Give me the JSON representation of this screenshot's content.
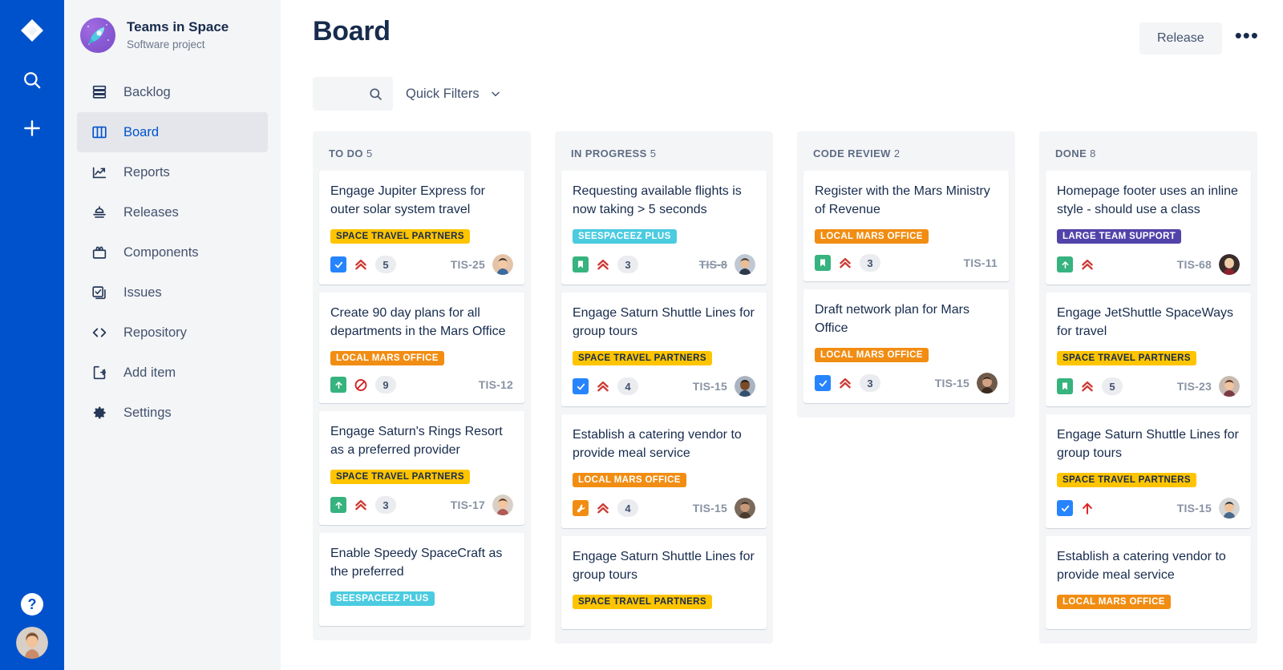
{
  "rail": {
    "logo_icon": "jira-logo-icon",
    "search_icon": "search-icon",
    "create_icon": "plus-icon",
    "help_label": "?",
    "avatar_icon": "user-avatar"
  },
  "sidebar": {
    "project": {
      "name": "Teams in Space",
      "subtitle": "Software project",
      "avatar_icon": "rocket-icon"
    },
    "items": [
      {
        "label": "Backlog",
        "icon": "backlog-icon",
        "active": false
      },
      {
        "label": "Board",
        "icon": "board-icon",
        "active": true
      },
      {
        "label": "Reports",
        "icon": "reports-icon",
        "active": false
      },
      {
        "label": "Releases",
        "icon": "releases-icon",
        "active": false
      },
      {
        "label": "Components",
        "icon": "components-icon",
        "active": false
      },
      {
        "label": "Issues",
        "icon": "issues-icon",
        "active": false
      },
      {
        "label": "Repository",
        "icon": "repository-icon",
        "active": false
      },
      {
        "label": "Add item",
        "icon": "add-item-icon",
        "active": false
      },
      {
        "label": "Settings",
        "icon": "settings-icon",
        "active": false
      }
    ]
  },
  "header": {
    "title": "Board",
    "release_label": "Release",
    "more_label": "•••",
    "more_icon": "ellipsis-icon"
  },
  "filters": {
    "search_value": "",
    "search_placeholder": "",
    "search_icon": "search-icon",
    "quick_filters_label": "Quick Filters",
    "chevron_icon": "chevron-down-icon"
  },
  "epic_colors": {
    "SPACE TRAVEL PARTNERS": {
      "bg": "#FFC400",
      "fg": "#172B4D"
    },
    "LOCAL MARS OFFICE": {
      "bg": "#F18D13",
      "fg": "#FFFFFF"
    },
    "SEESPACEEZ PLUS": {
      "bg": "#4BCBE0",
      "fg": "#FFFFFF"
    },
    "LARGE TEAM SUPPORT": {
      "bg": "#5243AA",
      "fg": "#FFFFFF"
    }
  },
  "board": {
    "columns": [
      {
        "title": "TO DO",
        "count": "5",
        "cards": [
          {
            "title": "Engage Jupiter Express for outer solar system travel",
            "epic": "SPACE TRAVEL PARTNERS",
            "type": "task",
            "priority": "high",
            "count": "5",
            "key": "TIS-25",
            "key_struck": false,
            "avatar": "avatar-m1"
          },
          {
            "title": "Create 90 day plans for all departments in the Mars Office",
            "epic": "LOCAL MARS OFFICE",
            "type": "improvement",
            "priority": "blocked",
            "count": "9",
            "key": "TIS-12",
            "key_struck": false,
            "avatar": null
          },
          {
            "title": "Engage Saturn's Rings Resort as a preferred provider",
            "epic": "SPACE TRAVEL PARTNERS",
            "type": "improvement",
            "priority": "high",
            "count": "3",
            "key": "TIS-17",
            "key_struck": false,
            "avatar": "avatar-f1"
          },
          {
            "title": "Enable Speedy SpaceCraft as the preferred",
            "epic": "SEESPACEEZ PLUS",
            "type": null,
            "priority": null,
            "count": null,
            "key": null,
            "key_struck": false,
            "avatar": null
          }
        ]
      },
      {
        "title": "IN PROGRESS",
        "count": "5",
        "cards": [
          {
            "title": "Requesting available flights is now taking > 5 seconds",
            "epic": "SEESPACEEZ PLUS",
            "type": "story",
            "priority": "high",
            "count": "3",
            "key": "TIS-8",
            "key_struck": true,
            "avatar": "avatar-m2"
          },
          {
            "title": "Engage Saturn Shuttle Lines for group tours",
            "epic": "SPACE TRAVEL PARTNERS",
            "type": "task",
            "priority": "high",
            "count": "4",
            "key": "TIS-15",
            "key_struck": false,
            "avatar": "avatar-m3"
          },
          {
            "title": "Establish a catering vendor to provide meal service",
            "epic": "LOCAL MARS OFFICE",
            "type": "bugfix",
            "priority": "high",
            "count": "4",
            "key": "TIS-15",
            "key_struck": false,
            "avatar": "avatar-f2"
          },
          {
            "title": "Engage Saturn Shuttle Lines for group tours",
            "epic": "SPACE TRAVEL PARTNERS",
            "type": null,
            "priority": null,
            "count": null,
            "key": null,
            "key_struck": false,
            "avatar": null
          }
        ]
      },
      {
        "title": "CODE REVIEW",
        "count": "2",
        "cards": [
          {
            "title": "Register with the Mars Ministry of Revenue",
            "epic": "LOCAL MARS OFFICE",
            "type": "story",
            "priority": "high",
            "count": "3",
            "key": "TIS-11",
            "key_struck": false,
            "avatar": null
          },
          {
            "title": "Draft network plan for Mars Office",
            "epic": "LOCAL MARS OFFICE",
            "type": "task",
            "priority": "high",
            "count": "3",
            "key": "TIS-15",
            "key_struck": false,
            "avatar": "avatar-f3"
          }
        ]
      },
      {
        "title": "DONE",
        "count": "8",
        "cards": [
          {
            "title": "Homepage footer uses an inline style - should use a class",
            "epic": "LARGE TEAM SUPPORT",
            "type": "improvement",
            "priority": "high",
            "count": null,
            "key": "TIS-68",
            "key_struck": false,
            "avatar": "avatar-f4"
          },
          {
            "title": "Engage JetShuttle SpaceWays for travel",
            "epic": "SPACE TRAVEL PARTNERS",
            "type": "story",
            "priority": "high",
            "count": "5",
            "key": "TIS-23",
            "key_struck": false,
            "avatar": "avatar-f5"
          },
          {
            "title": "Engage Saturn Shuttle Lines for group tours",
            "epic": "SPACE TRAVEL PARTNERS",
            "type": "task",
            "priority": "highest",
            "count": null,
            "key": "TIS-15",
            "key_struck": false,
            "avatar": "avatar-m4"
          },
          {
            "title": "Establish a catering vendor to provide meal service",
            "epic": "LOCAL MARS OFFICE",
            "type": null,
            "priority": null,
            "count": null,
            "key": null,
            "key_struck": false,
            "avatar": null
          }
        ]
      }
    ]
  }
}
